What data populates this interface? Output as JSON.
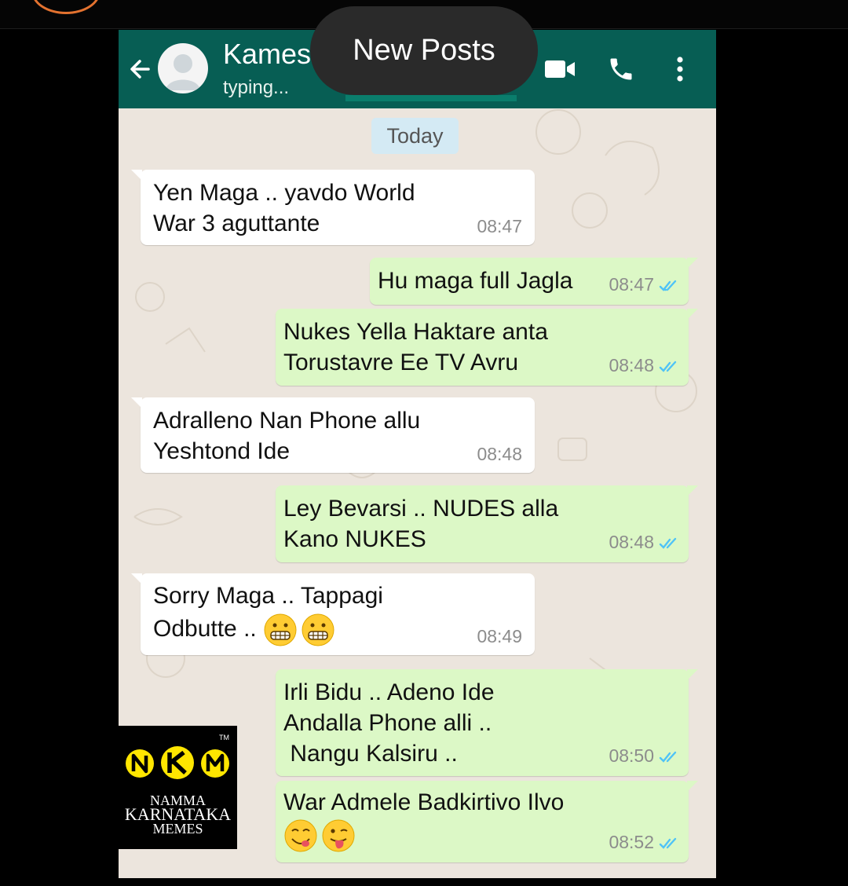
{
  "header": {
    "contact_name": "Kames",
    "status": "typing...",
    "back_icon": "arrow-left-icon",
    "video_icon": "video-camera-icon",
    "call_icon": "phone-icon",
    "menu_icon": "more-vert-icon"
  },
  "overlay": {
    "new_posts": "New Posts"
  },
  "date_chip": "Today",
  "messages": [
    {
      "side": "incoming",
      "text": "Yen Maga .. yavdo World\nWar 3 aguttante",
      "time": "08:47"
    },
    {
      "side": "outgoing",
      "text": "Hu maga full Jagla",
      "time": "08:47",
      "status": "read"
    },
    {
      "side": "outgoing",
      "text": "Nukes Yella Haktare anta\nTorustavre Ee TV Avru",
      "time": "08:48",
      "status": "read"
    },
    {
      "side": "incoming",
      "text": "Adralleno Nan Phone allu\nYeshtond Ide",
      "time": "08:48"
    },
    {
      "side": "outgoing",
      "text": "Ley Bevarsi .. NUDES alla\nKano NUKES",
      "time": "08:48",
      "status": "read"
    },
    {
      "side": "incoming",
      "text": "Sorry Maga .. Tappagi\nOdbutte .. ",
      "time": "08:49",
      "emojis": [
        "grimacing-face",
        "grimacing-face"
      ]
    },
    {
      "side": "outgoing",
      "text": "Irli Bidu .. Adeno Ide\nAndalla Phone alli ..\n Nangu Kalsiru ..",
      "time": "08:50",
      "status": "read"
    },
    {
      "side": "outgoing",
      "text": "War Admele Badkirtivo Ilvo\n",
      "time": "08:52",
      "status": "read",
      "emojis": [
        "face-savoring-food",
        "face-with-tongue"
      ]
    }
  ],
  "watermark": {
    "letters": [
      "N",
      "K",
      "M"
    ],
    "tm": "TM",
    "line1": "NAMMA",
    "line2": "KARNATAKA",
    "line3": "MEMES"
  },
  "colors": {
    "header": "#075e54",
    "chat_bg": "#ece5dd",
    "incoming": "#ffffff",
    "outgoing": "#dcf8c6",
    "read_ticks": "#4fc3f7",
    "date_chip": "#d4eaf4",
    "logo_yellow": "#ffe600"
  }
}
